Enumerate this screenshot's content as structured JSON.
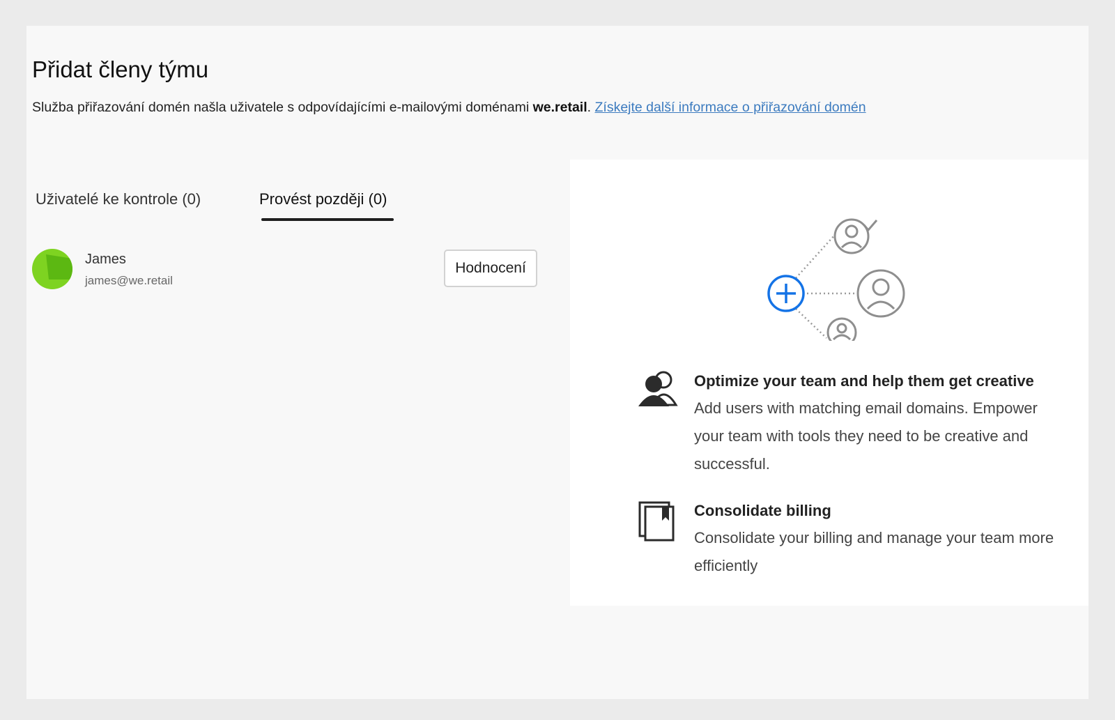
{
  "header": {
    "title": "Přidat členy týmu",
    "intro_text": "Služba přiřazování domén našla uživatele s odpovídajícími e-mailovými doménami",
    "domain": "we.retail",
    "intro_period": ".",
    "help_link": "Získejte další informace o přiřazování domén"
  },
  "tabs": [
    {
      "label": "Uživatelé ke kontrole (0)",
      "selected": false
    },
    {
      "label": "Provést později (0)",
      "selected": true
    }
  ],
  "users": [
    {
      "name": "James",
      "email": "james@we.retail",
      "action_label": "Hodnocení",
      "avatar_color": "#7ed321"
    }
  ],
  "promo": {
    "illustration": {
      "add_icon": "plus-circle-icon",
      "user_icons": [
        "user-check-icon",
        "user-icon",
        "user-icon"
      ],
      "accent": "#1473e6"
    },
    "features": [
      {
        "icon": "users-icon",
        "title": "Optimize your team and help them get creative",
        "body": "Add users with matching email domains. Empower your team with tools they need to be creative and successful."
      },
      {
        "icon": "billing-icon",
        "title": "Consolidate billing",
        "body": "Consolidate your billing and manage your team more efficiently"
      }
    ]
  },
  "colors": {
    "page_background": "#ebebeb",
    "panel_background": "#f8f8f8",
    "link": "#3c7bbf",
    "accent": "#1473e6"
  }
}
